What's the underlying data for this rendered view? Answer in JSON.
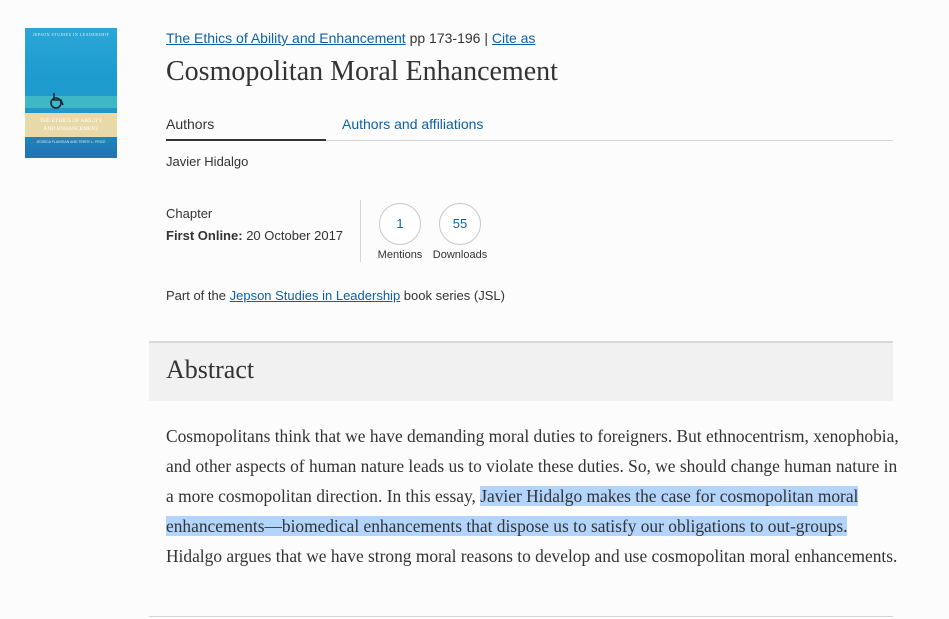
{
  "cover": {
    "series_text": "JEPSON STUDIES IN LEADERSHIP",
    "title_line1": "THE ETHICS OF ABILITY",
    "title_line2": "AND ENHANCEMENT",
    "editors": "JESSICA FLANIGAN AND TERRY L. PRICE"
  },
  "meta": {
    "book_link": "The Ethics of Ability and Enhancement",
    "pages": "pp 173-196",
    "separator": "|",
    "cite_link": "Cite as"
  },
  "title": "Cosmopolitan Moral Enhancement",
  "tabs": [
    {
      "label": "Authors"
    },
    {
      "label": "Authors and affiliations"
    }
  ],
  "author": "Javier Hidalgo",
  "chapter": {
    "type": "Chapter",
    "first_online_label": "First Online:",
    "first_online_date": "20 October 2017"
  },
  "metrics": [
    {
      "value": "1",
      "label": "Mentions"
    },
    {
      "value": "55",
      "label": "Downloads"
    }
  ],
  "series": {
    "prefix": "Part of the",
    "link": "Jepson Studies in Leadership",
    "suffix": "book series (JSL)"
  },
  "abstract": {
    "heading": "Abstract",
    "text_before": "Cosmopolitans think that we have demanding moral duties to foreigners. But ethnocentrism, xenophobia, and other aspects of human nature leads us to violate these duties. So, we should change human nature in a more cosmopolitan direction. In this essay, ",
    "text_highlighted": "Javier Hidalgo makes the case for cosmopolitan moral enhancements—biomedical enhancements that dispose us to satisfy our obligations to out-groups.",
    "text_after": " Hidalgo argues that we have strong moral reasons to develop and use cosmopolitan moral enhancements."
  },
  "colors": {
    "link": "#0c61a6",
    "highlight": "#b3d4fc",
    "abstract_bg": "#f1f1f1"
  }
}
